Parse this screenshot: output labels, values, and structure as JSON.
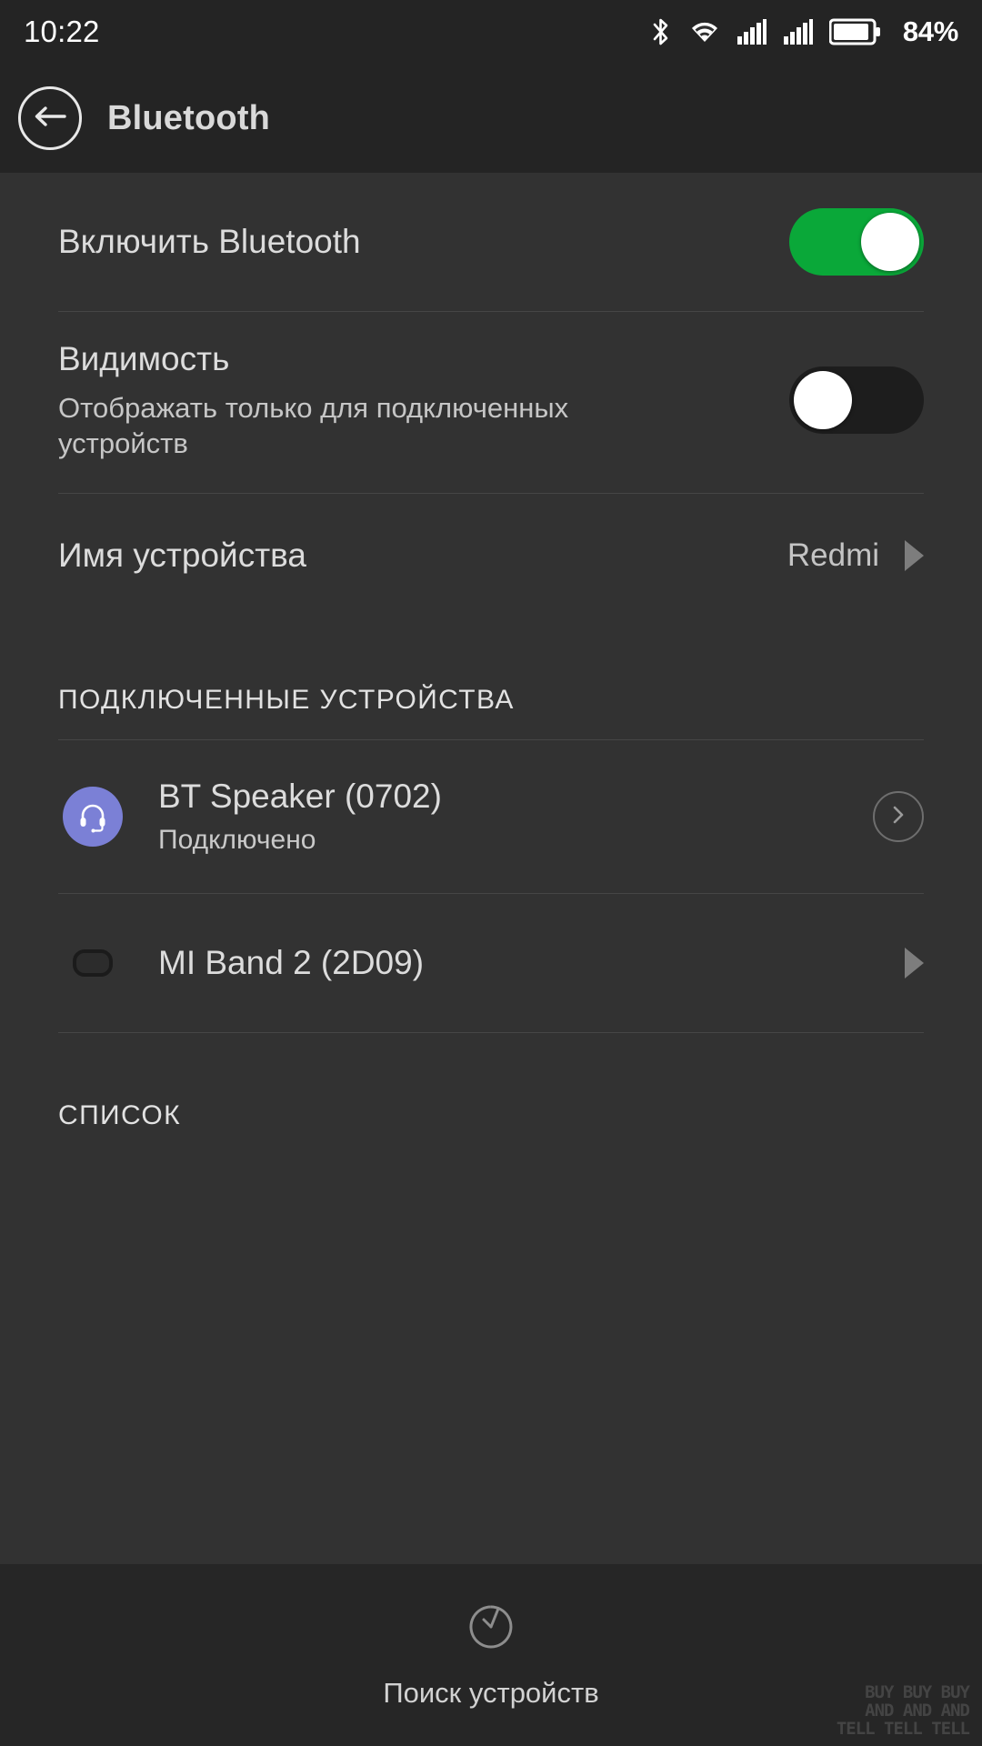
{
  "status_bar": {
    "time": "10:22",
    "battery_percent": "84%",
    "icons": [
      "bluetooth-icon",
      "wifi-icon",
      "signal-sim1-icon",
      "signal-sim2-icon",
      "battery-icon"
    ]
  },
  "app_bar": {
    "back_icon": "back-arrow-icon",
    "title": "Bluetooth"
  },
  "settings": {
    "enable_bluetooth": {
      "title": "Включить Bluetooth",
      "state": "on"
    },
    "visibility": {
      "title": "Видимость",
      "subtitle": "Отображать только для подключенных устройств",
      "state": "off"
    },
    "device_name": {
      "title": "Имя устройства",
      "value": "Redmi",
      "chevron_icon": "chevron-right-icon"
    }
  },
  "sections": {
    "paired": {
      "header": "ПОДКЛЮЧЕННЫЕ УСТРОЙСТВА",
      "devices": [
        {
          "name": "BT Speaker (0702)",
          "status": "Подключено",
          "icon": "headset-icon",
          "action_icon": "circle-chevron-right-icon"
        },
        {
          "name": "MI Band 2 (2D09)",
          "status": "",
          "icon": "band-icon",
          "action_icon": "chevron-right-icon"
        }
      ]
    },
    "list": {
      "header": "СПИСОК"
    }
  },
  "bottom_bar": {
    "scan_icon": "scan-refresh-icon",
    "scan_label": "Поиск устройств"
  },
  "watermark": {
    "line1": "BUY BUY BUY",
    "line2": "AND AND AND",
    "line3": "TELL TELL TELL"
  },
  "colors": {
    "accent_green": "#0aa839",
    "avatar_purple": "#7b80d6",
    "background": "#323232",
    "bar_background": "#242424"
  }
}
